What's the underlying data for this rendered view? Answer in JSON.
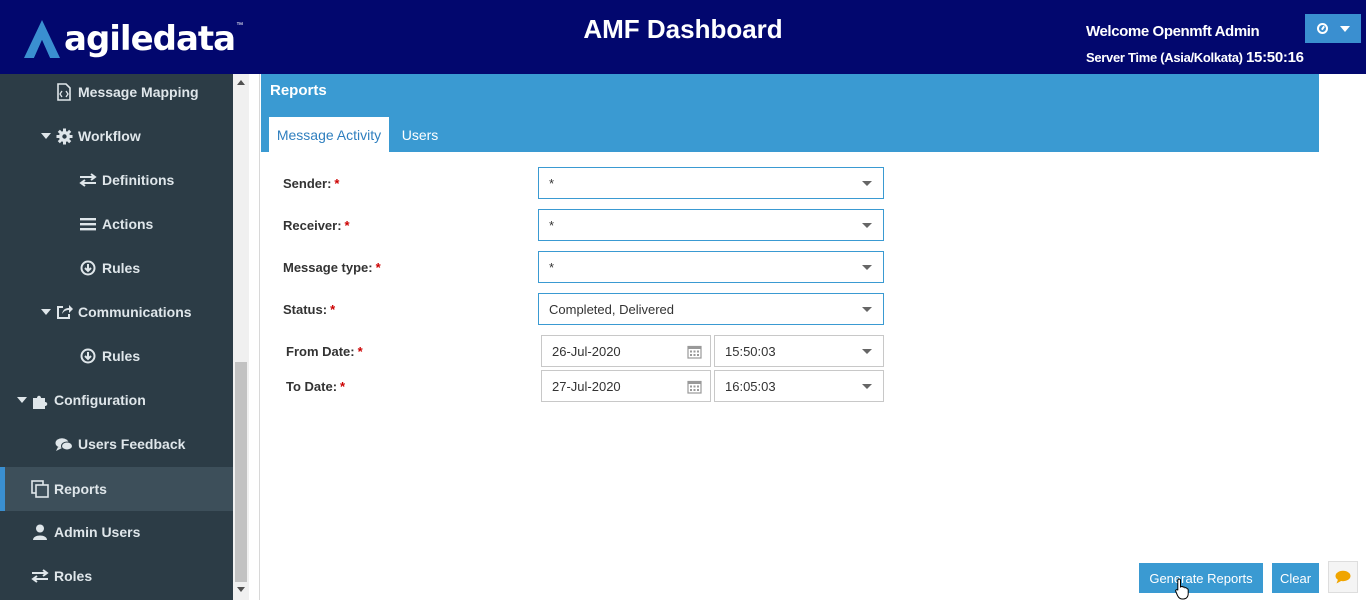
{
  "header": {
    "logo_text": "agiledata",
    "logo_tm": "™",
    "title": "AMF Dashboard",
    "welcome": "Welcome Openmft Admin",
    "server_time_label": "Server Time (Asia/Kolkata)",
    "server_time_value": "15:50:16",
    "bg_color": "#02076e",
    "accent_color": "#3a8fd0"
  },
  "sidebar": {
    "items": [
      {
        "label": "Message Mapping",
        "icon": "code-file-icon"
      },
      {
        "label": "Workflow",
        "icon": "gear-icon",
        "expanded": true
      },
      {
        "label": "Definitions",
        "icon": "exchange-icon"
      },
      {
        "label": "Actions",
        "icon": "list-icon"
      },
      {
        "label": "Rules",
        "icon": "circle-arrow-down-icon"
      },
      {
        "label": "Communications",
        "icon": "share-icon",
        "expanded": true
      },
      {
        "label": "Rules",
        "icon": "circle-arrow-down-icon"
      },
      {
        "label": "Configuration",
        "icon": "puzzle-icon",
        "expanded": true
      },
      {
        "label": "Users Feedback",
        "icon": "comments-icon"
      },
      {
        "label": "Reports",
        "icon": "copy-icon",
        "active": true
      },
      {
        "label": "Admin Users",
        "icon": "user-icon"
      },
      {
        "label": "Roles",
        "icon": "exchange-icon"
      }
    ]
  },
  "panel": {
    "title": "Reports",
    "tabs": [
      {
        "label": "Message Activity",
        "active": true
      },
      {
        "label": "Users",
        "active": false
      }
    ]
  },
  "form": {
    "sender": {
      "label": "Sender:",
      "value": "*"
    },
    "receiver": {
      "label": "Receiver:",
      "value": "*"
    },
    "message_type": {
      "label": "Message type:",
      "value": "*"
    },
    "status": {
      "label": "Status:",
      "value": "Completed, Delivered"
    },
    "from_date": {
      "label": "From Date:",
      "date": "26-Jul-2020",
      "time": "15:50:03"
    },
    "to_date": {
      "label": "To Date:",
      "date": "27-Jul-2020",
      "time": "16:05:03"
    },
    "required_mark": "*"
  },
  "actions": {
    "generate_label": "Generate Reports",
    "clear_label": "Clear",
    "chat_icon": "comment-icon"
  }
}
